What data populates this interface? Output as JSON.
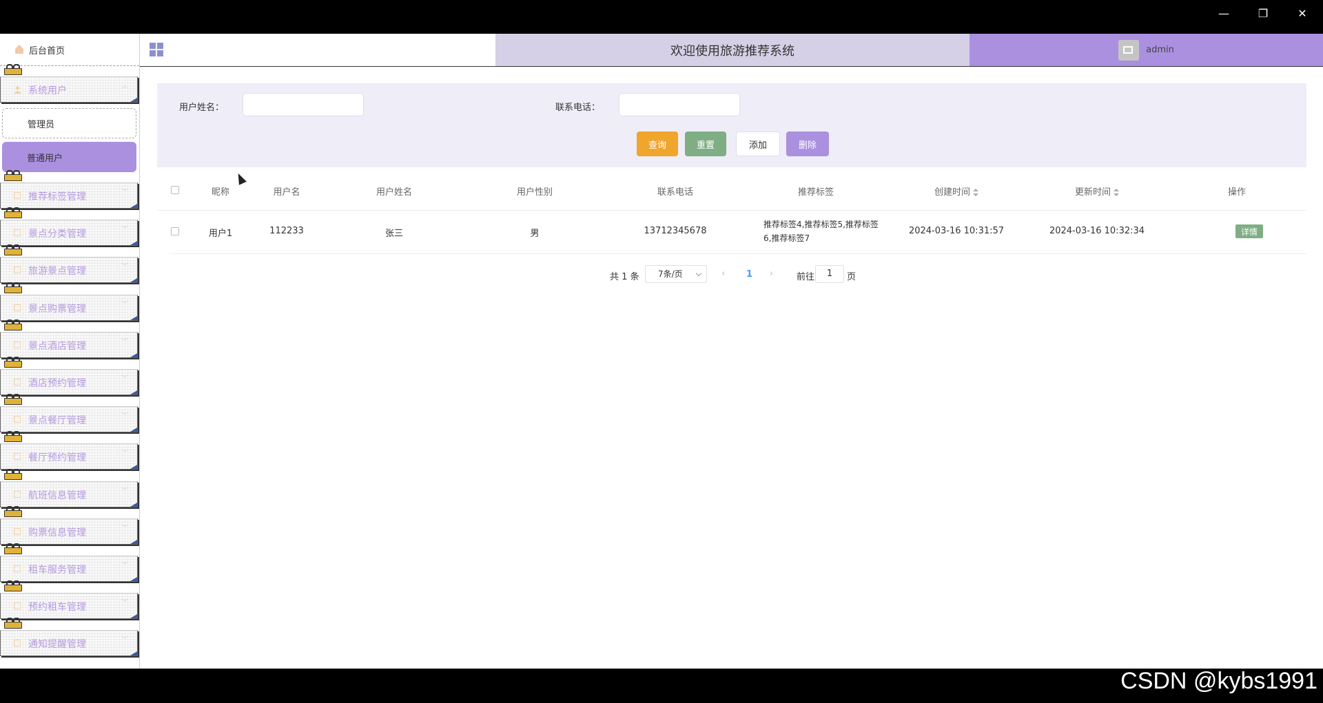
{
  "window": {
    "minimize": "—",
    "maximize": "❐",
    "close": "✕"
  },
  "sidebar": {
    "home_label": "后台首页",
    "group_label": "系统用户",
    "sub_items": [
      {
        "label": "管理员",
        "active": false
      },
      {
        "label": "普通用户",
        "active": true
      }
    ],
    "menus": [
      "推荐标签管理",
      "景点分类管理",
      "旅游景点管理",
      "景点购票管理",
      "景点酒店管理",
      "酒店预约管理",
      "景点餐厅管理",
      "餐厅预约管理",
      "航班信息管理",
      "购票信息管理",
      "租车服务管理",
      "预约租车管理",
      "通知提醒管理"
    ]
  },
  "header": {
    "title": "欢迎使用旅游推荐系统",
    "username": "admin"
  },
  "search": {
    "name_label": "用户姓名：",
    "phone_label": "联系电话：",
    "name_value": "",
    "phone_value": "",
    "query_label": "查询",
    "reset_label": "重置",
    "add_label": "添加",
    "delete_label": "删除"
  },
  "table": {
    "columns": [
      "昵称",
      "用户名",
      "用户姓名",
      "用户性别",
      "联系电话",
      "推荐标签",
      "创建时间",
      "更新时间",
      "操作"
    ],
    "rows": [
      {
        "nickname": "用户1",
        "username": "112233",
        "realname": "张三",
        "gender": "男",
        "phone": "13712345678",
        "tags": "推荐标签4,推荐标签5,推荐标签6,推荐标签7",
        "created": "2024-03-16 10:31:57",
        "updated": "2024-03-16 10:32:34",
        "action": "详情"
      }
    ]
  },
  "pagination": {
    "total_text": "共 1 条",
    "page_size": "7条/页",
    "current_page": "1",
    "goto_label": "前往",
    "goto_value": "1",
    "page_unit": "页"
  },
  "watermark": "CSDN @kybs1991"
}
